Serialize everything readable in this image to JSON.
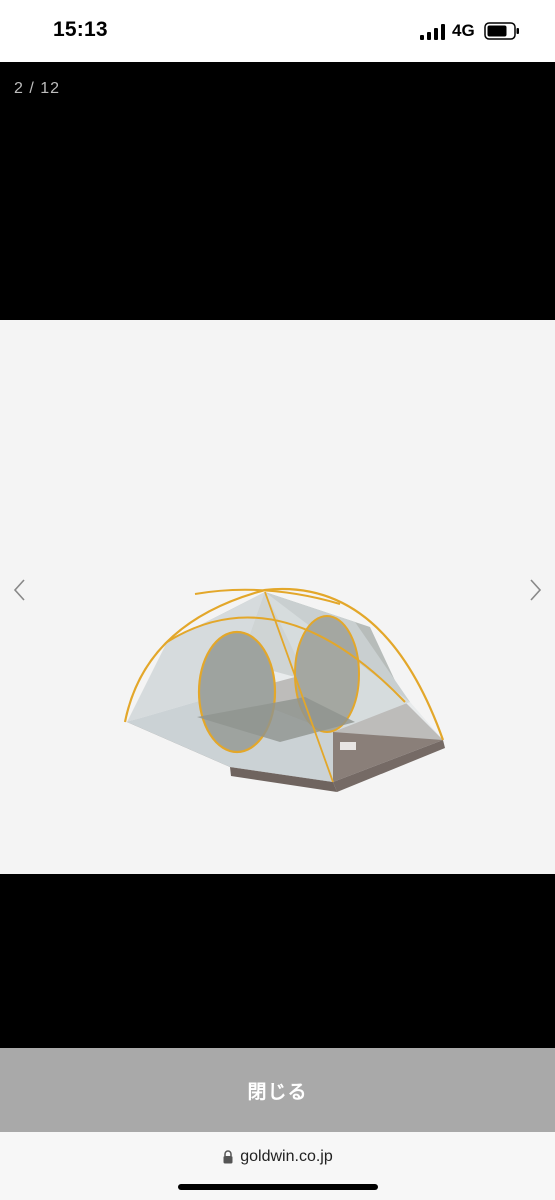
{
  "status_bar": {
    "time": "15:13",
    "network": "4G",
    "icons": [
      "signal-icon",
      "battery-icon"
    ]
  },
  "viewer": {
    "page_counter": "2 / 12",
    "image_subject": "tent-image",
    "nav_icons": [
      "chevron-left-icon",
      "chevron-right-icon"
    ],
    "colors": {
      "backdrop": "#000000",
      "image_background": "#f4f4f4",
      "tent_pole": "#e3a72a",
      "tent_body": "#c8ced1",
      "tent_floor": "#7c716c"
    }
  },
  "close_bar": {
    "label": "閉じる",
    "background": "#a9a9a9"
  },
  "browser": {
    "url": "goldwin.co.jp",
    "icon": "lock-icon"
  }
}
